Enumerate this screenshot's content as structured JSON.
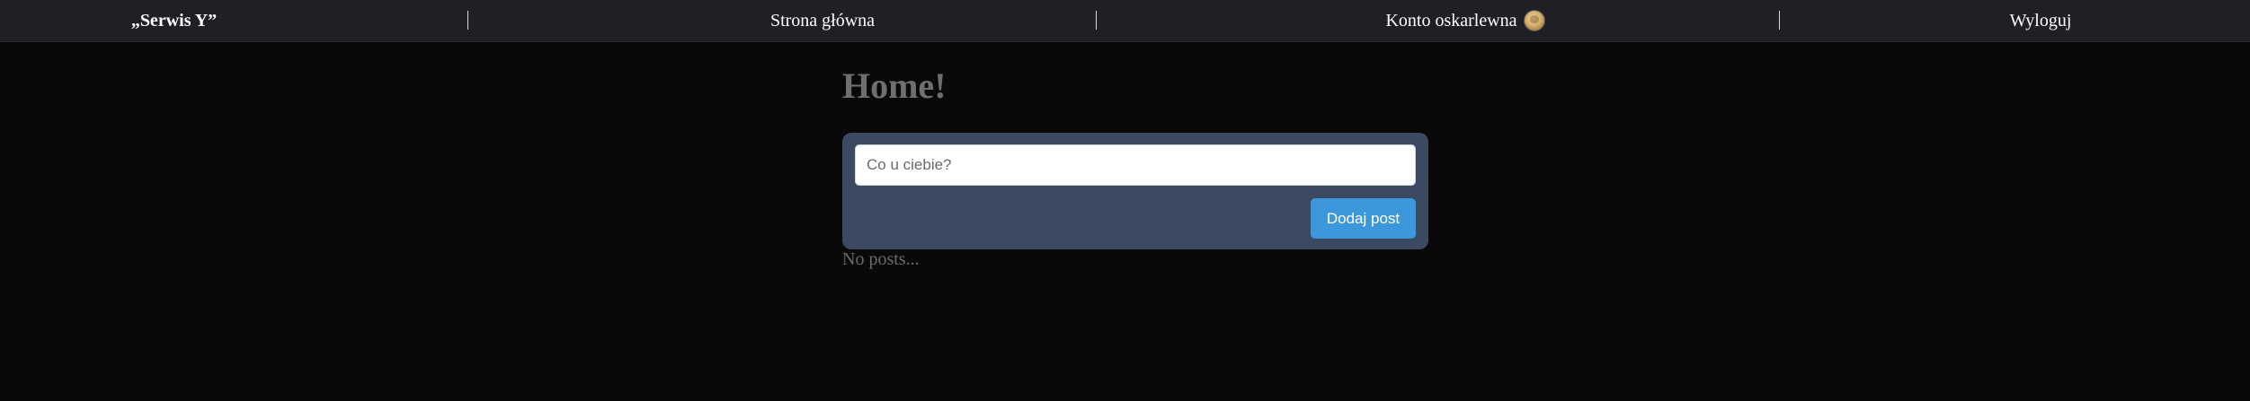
{
  "nav": {
    "brand": "„Serwis Y”",
    "separator": "|",
    "home": "Strona główna",
    "account": "Konto oskarlewna",
    "logout": "Wyloguj"
  },
  "main": {
    "title": "Home!",
    "composer": {
      "placeholder": "Co u ciebie?",
      "value": "",
      "submit_label": "Dodaj post"
    },
    "empty_state": "No posts..."
  },
  "colors": {
    "background": "#090909",
    "topbar": "#1f2025",
    "card": "#3b4a60",
    "button": "#3d98db",
    "muted_text": "#6f6f6f"
  },
  "icons": {
    "avatar": "user-avatar"
  }
}
